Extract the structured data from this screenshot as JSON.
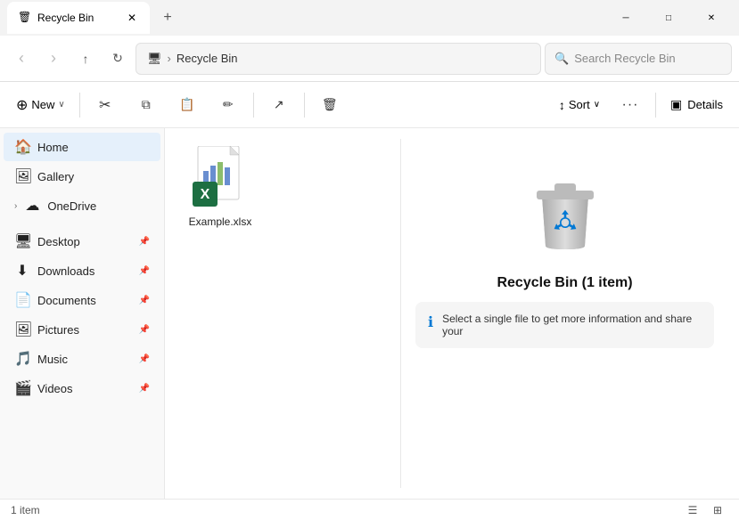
{
  "titlebar": {
    "tab_title": "Recycle Bin",
    "tab_close": "✕",
    "tab_add": "+",
    "win_minimize": "─",
    "win_maximize": "□",
    "win_close": "✕"
  },
  "navbar": {
    "back": "‹",
    "forward": "›",
    "up": "↑",
    "refresh": "↻",
    "monitor_icon": "🖥",
    "separator": "›",
    "path": "Recycle Bin",
    "search_placeholder": "Search Recycle Bin",
    "search_icon": "🔍"
  },
  "toolbar": {
    "new_label": "New",
    "new_icon": "⊕",
    "new_chevron": "∨",
    "cut_icon": "✂",
    "copy_icon": "⧉",
    "paste_icon": "📋",
    "rename_icon": "✏",
    "share_icon": "↗",
    "delete_icon": "🗑",
    "sort_icon": "↕",
    "sort_label": "Sort",
    "sort_chevron": "∨",
    "more_icon": "···",
    "details_icon": "▣",
    "details_label": "Details"
  },
  "sidebar": {
    "items": [
      {
        "label": "Home",
        "icon": "🏠",
        "active": true,
        "expandable": false,
        "pin": false
      },
      {
        "label": "Gallery",
        "icon": "🖼",
        "active": false,
        "expandable": false,
        "pin": false
      },
      {
        "label": "OneDrive",
        "icon": "☁",
        "active": false,
        "expandable": true,
        "pin": false
      },
      {
        "label": "Desktop",
        "icon": "🖥",
        "active": false,
        "expandable": false,
        "pin": true
      },
      {
        "label": "Downloads",
        "icon": "⬇",
        "active": false,
        "expandable": false,
        "pin": true
      },
      {
        "label": "Documents",
        "icon": "📄",
        "active": false,
        "expandable": false,
        "pin": true
      },
      {
        "label": "Pictures",
        "icon": "🖼",
        "active": false,
        "expandable": false,
        "pin": true
      },
      {
        "label": "Music",
        "icon": "🎵",
        "active": false,
        "expandable": false,
        "pin": true
      },
      {
        "label": "Videos",
        "icon": "🎬",
        "active": false,
        "expandable": false,
        "pin": true
      }
    ]
  },
  "files": [
    {
      "name": "Example.xlsx",
      "type": "xlsx"
    }
  ],
  "right_panel": {
    "title": "Recycle Bin (1 item)",
    "info_text": "Select a single file to get more information and share your",
    "info_icon": "ℹ"
  },
  "statusbar": {
    "count": "1 item",
    "view_list": "☰",
    "view_grid": "⊞"
  }
}
